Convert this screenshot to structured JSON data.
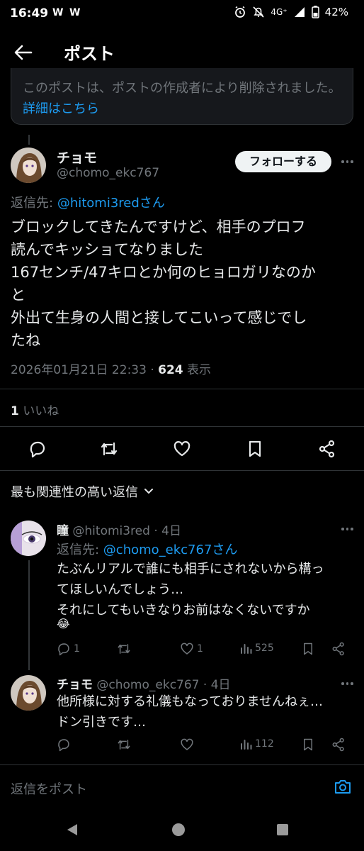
{
  "status": {
    "time": "16:49",
    "notif_1": "W",
    "notif_2": "W",
    "network": "4G⁺",
    "battery": "42%"
  },
  "header": {
    "title": "ポスト"
  },
  "notice": {
    "text": "このポストは、ポストの作成者により削除されました。",
    "link": "詳細はこちら"
  },
  "post": {
    "name": "チョモ",
    "handle": "@chomo_ekc767",
    "follow_label": "フォローする",
    "reply_prefix": "返信先:",
    "reply_to": "@hitomi3redさん",
    "text": "ブロックしてきたんですけど、相手のプロフ\n読んでキッショてなりました\n167センチ/47キロとか何のヒョロガリなのか\nと\n外出て生身の人間と接してこいって感じでし\nたね",
    "timestamp": "2026年01月21日 22:33 · ",
    "views": "624",
    "views_label": " 表示",
    "likes_count": "1",
    "likes_label": " いいね"
  },
  "replies_header": {
    "label": "最も関連性の高い返信"
  },
  "replies": [
    {
      "name": "瞳",
      "handle": "@hitomi3red · 4日",
      "reply_prefix": "返信先: ",
      "reply_to": "@chomo_ekc767さん",
      "text": "たぶんリアルで誰にも相手にされないから構っ\nてほしいんでしょう…\nそれにしてもいきなりお前はなくないですか",
      "emoji": "😂",
      "reply_count": "1",
      "retweet_count": "",
      "like_count": "1",
      "view_count": "525"
    },
    {
      "name": "チョモ",
      "handle": "@chomo_ekc767 · 4日",
      "text": "他所様に対する礼儀もなっておりませんねぇ…\nドン引きです…",
      "reply_count": "",
      "retweet_count": "",
      "like_count": "",
      "view_count": "112"
    }
  ],
  "composer": {
    "placeholder": "返信をポスト"
  },
  "colors": {
    "accent": "#1d9bf0",
    "background": "#000000",
    "muted": "#71767b"
  },
  "icons": [
    "back-arrow-icon",
    "reply-icon",
    "retweet-icon",
    "like-icon",
    "bookmark-icon",
    "share-icon",
    "views-icon",
    "camera-icon",
    "chevron-down-icon",
    "more-icon"
  ]
}
